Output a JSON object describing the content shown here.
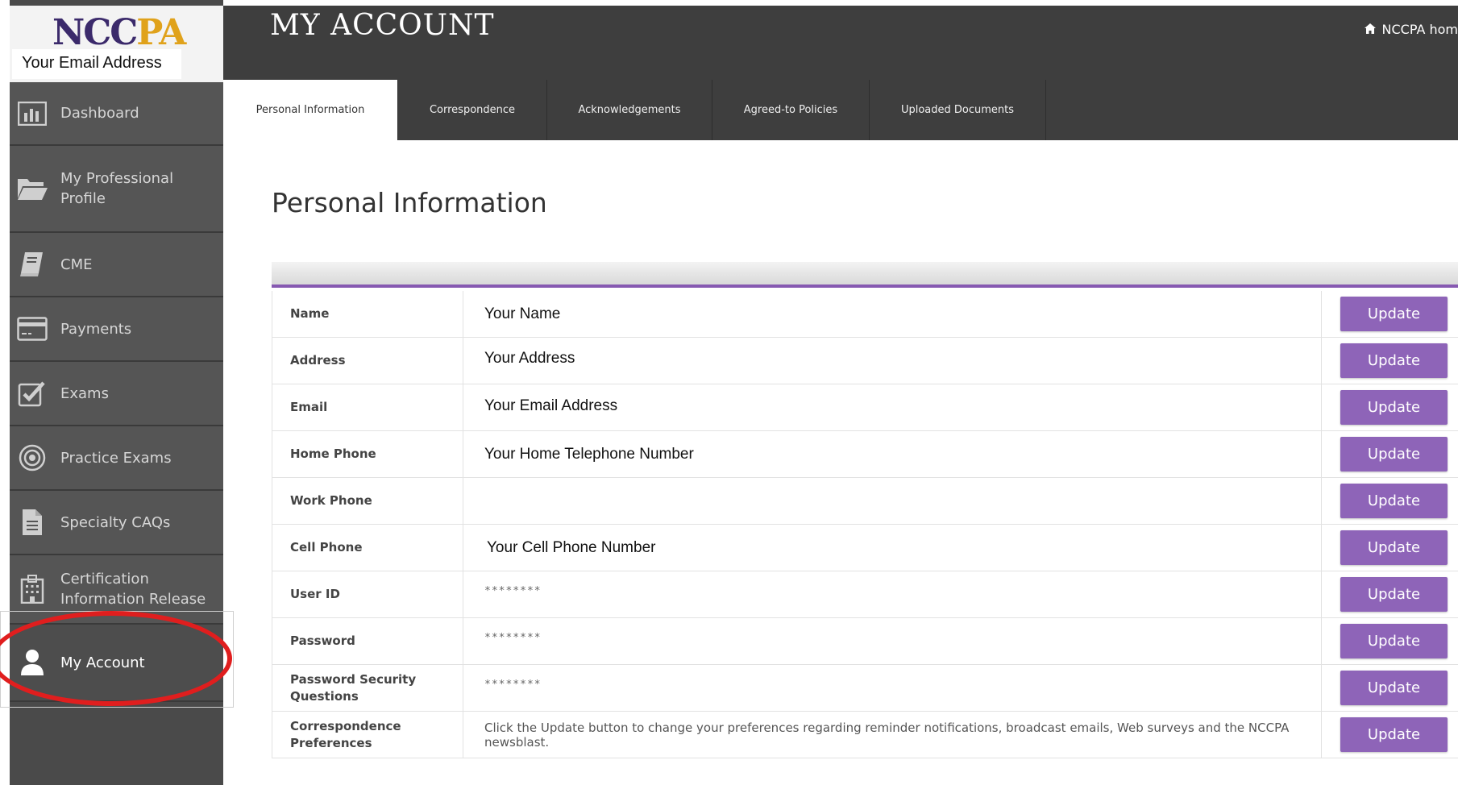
{
  "brand": {
    "logo_main": "NCC",
    "logo_sun": "PA",
    "user_email": "Your Email Address"
  },
  "header": {
    "title": "MY ACCOUNT",
    "home_link": "NCCPA hom",
    "home_icon": "home-icon"
  },
  "sidebar": {
    "items": [
      {
        "label": "Dashboard",
        "icon": "bar-chart-icon"
      },
      {
        "label": "My Professional Profile",
        "icon": "folder-open-icon"
      },
      {
        "label": "CME",
        "icon": "book-icon"
      },
      {
        "label": "Payments",
        "icon": "credit-card-icon"
      },
      {
        "label": "Exams",
        "icon": "checkbox-icon"
      },
      {
        "label": "Practice Exams",
        "icon": "target-icon"
      },
      {
        "label": "Specialty CAQs",
        "icon": "document-icon"
      },
      {
        "label": "Certification Information Release",
        "icon": "building-icon"
      },
      {
        "label": "My Account",
        "icon": "user-icon",
        "active": true
      }
    ]
  },
  "tabs": [
    {
      "label": "Personal Information",
      "active": true
    },
    {
      "label": "Correspondence"
    },
    {
      "label": "Acknowledgements"
    },
    {
      "label": "Agreed-to Policies"
    },
    {
      "label": "Uploaded Documents"
    }
  ],
  "section": {
    "title": "Personal Information"
  },
  "fields": [
    {
      "label": "Name",
      "value": "Your Name",
      "button": "Update"
    },
    {
      "label": "Address",
      "value": "Your Address",
      "button": "Update"
    },
    {
      "label": "Email",
      "value": "Your Email Address",
      "button": "Update"
    },
    {
      "label": "Home Phone",
      "value": "Your Home Telephone Number",
      "button": "Update"
    },
    {
      "label": "Work Phone",
      "value": "",
      "button": "Update"
    },
    {
      "label": "Cell Phone",
      "value": "Your Cell Phone Number",
      "button": "Update"
    },
    {
      "label": "User ID",
      "value": "********",
      "button": "Update"
    },
    {
      "label": "Password",
      "value": "********",
      "button": "Update"
    },
    {
      "label": "Password Security Questions",
      "value": "********",
      "button": "Update"
    },
    {
      "label": "Correspondence Preferences",
      "value": "Click the Update button to change your preferences regarding reminder notifications, broadcast emails, Web surveys and the NCCPA newsblast.",
      "button": "Update"
    }
  ],
  "colors": {
    "accent_purple": "#8e64b8",
    "sidebar_bg": "#555555",
    "topbar_bg": "#3e3e3e",
    "highlight_red": "#e01e1e"
  }
}
